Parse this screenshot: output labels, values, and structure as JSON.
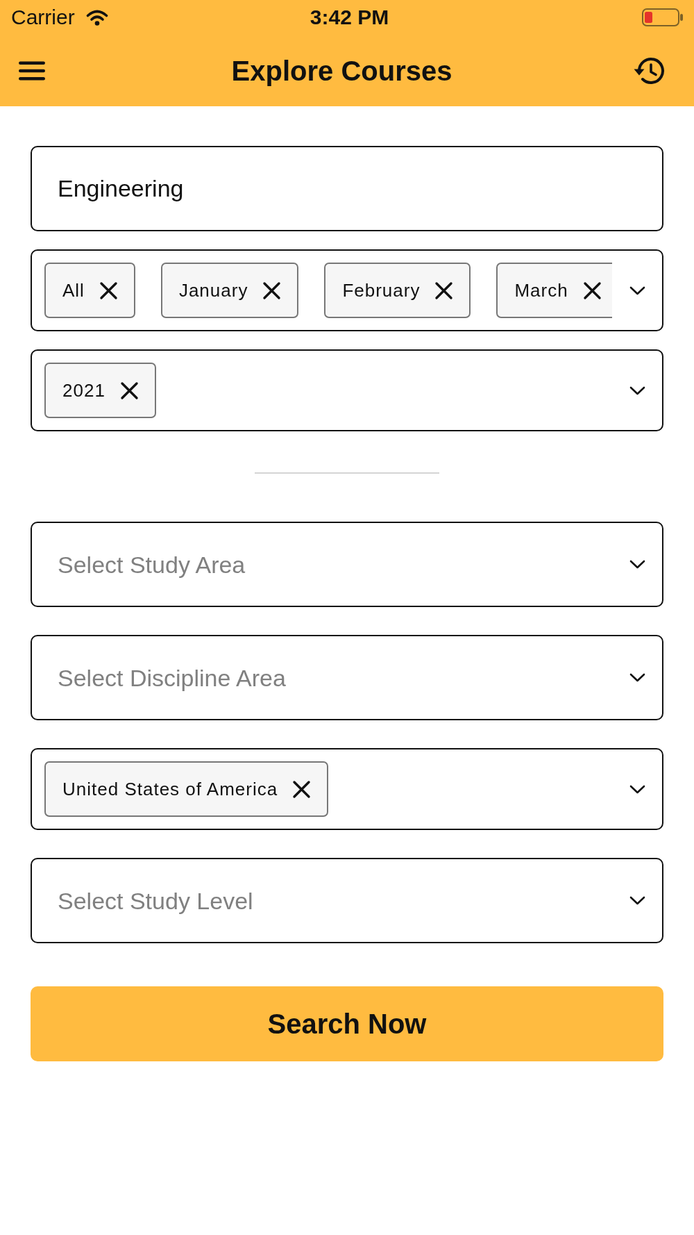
{
  "status_bar": {
    "carrier": "Carrier",
    "time": "3:42 PM"
  },
  "header": {
    "title": "Explore Courses"
  },
  "search": {
    "value": "Engineering"
  },
  "date_filters": [
    {
      "kind": "chips",
      "chips": [
        "All",
        "January",
        "February",
        "March"
      ]
    },
    {
      "kind": "chips",
      "chips": [
        "2021"
      ]
    }
  ],
  "select_fields": [
    {
      "kind": "placeholder",
      "placeholder": "Select Study Area"
    },
    {
      "kind": "placeholder",
      "placeholder": "Select Discipline Area"
    },
    {
      "kind": "chips",
      "chips": [
        "United States of America"
      ]
    },
    {
      "kind": "placeholder",
      "placeholder": "Select Study Level"
    }
  ],
  "search_button": {
    "label": "Search Now"
  }
}
